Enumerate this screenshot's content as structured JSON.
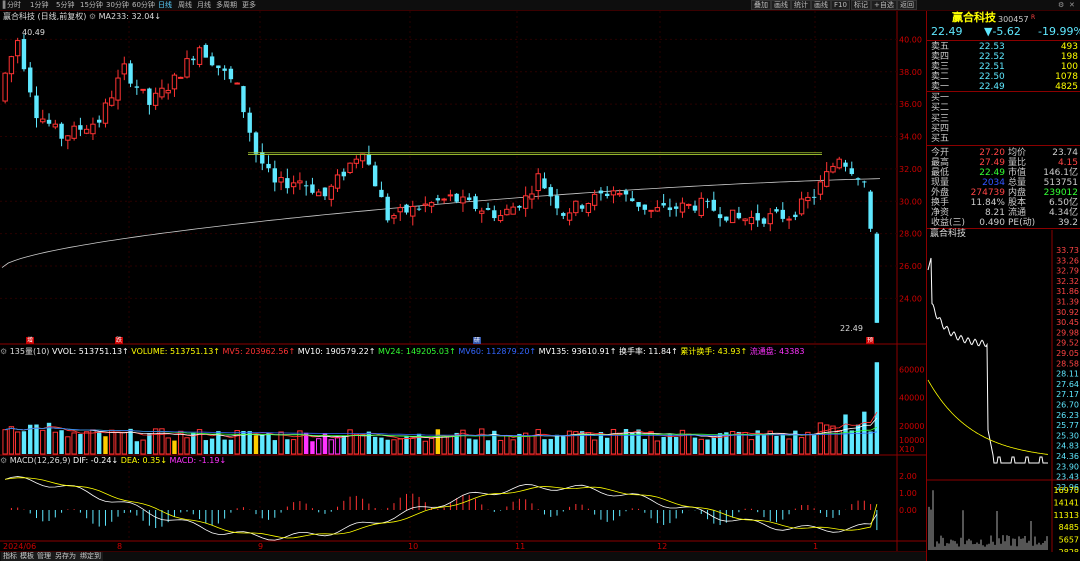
{
  "toolbar": {
    "periods": [
      "分时",
      "1分钟",
      "5分钟",
      "15分钟",
      "30分钟",
      "60分钟",
      "日线",
      "周线",
      "月线",
      "多周期",
      "更多"
    ],
    "active_period": "日线",
    "right_buttons": [
      "叠加",
      "画线",
      "统计",
      "画线",
      "F10",
      "标记",
      "+自选",
      "返回"
    ],
    "right_icons": [
      "settings-icon",
      "close-icon"
    ]
  },
  "chart_header": {
    "stock_name": "赢合科技",
    "mode": "(日线,前复权)",
    "ma_label": "MA233: 32.04↓"
  },
  "price_axis_labels": [
    "40.00",
    "38.00",
    "36.00",
    "34.00",
    "32.00",
    "30.00",
    "28.00",
    "26.00",
    "24.00"
  ],
  "high_label": "40.49",
  "low_label": "22.49",
  "markers": [
    "增",
    "跌",
    "研",
    "预"
  ],
  "volume_header": {
    "left": "135量(10)",
    "items": [
      {
        "text": "VVOL: 513751.13↑",
        "color": "#ffffff"
      },
      {
        "text": "VOLUME: 513751.13↑",
        "color": "#ffff00"
      },
      {
        "text": "MV5: 203962.56↑",
        "color": "#ff3333"
      },
      {
        "text": "MV10: 190579.22↑",
        "color": "#ffffff"
      },
      {
        "text": "MV24: 149205.03↑",
        "color": "#33ff33"
      },
      {
        "text": "MV60: 112879.20↑",
        "color": "#3366ff"
      },
      {
        "text": "MV135: 93610.91↑",
        "color": "#ffffff"
      },
      {
        "text": "换手率: 11.84↑",
        "color": "#ffffff"
      },
      {
        "text": "累计换手: 43.93↑",
        "color": "#ffff00"
      },
      {
        "text": "流通盘: 43383",
        "color": "#ff33ff"
      }
    ]
  },
  "volume_axis_labels": [
    "60000",
    "40000",
    "20000",
    "10000",
    "X10"
  ],
  "macd_header": {
    "left": "MACD(12,26,9)",
    "items": [
      {
        "text": "DIF: -0.24↓",
        "color": "#ffffff"
      },
      {
        "text": "DEA: 0.35↓",
        "color": "#ffff00"
      },
      {
        "text": "MACD: -1.19↓",
        "color": "#ff33ff"
      }
    ]
  },
  "macd_axis_labels": [
    "2.00",
    "1.00",
    "0.00"
  ],
  "date_labels": [
    "2024/06",
    "8",
    "9",
    "10",
    "11",
    "12",
    "1"
  ],
  "bottom_tabs": [
    "指标",
    "模板",
    "管理",
    "另存为",
    "绑定到"
  ],
  "quote": {
    "name": "赢合科技",
    "code": "300457",
    "last_price": "22.49",
    "change": "▼-5.62",
    "change_pct": "-19.99%",
    "asks": [
      {
        "label": "卖五",
        "price": "22.53",
        "vol": "493"
      },
      {
        "label": "卖四",
        "price": "22.52",
        "vol": "198"
      },
      {
        "label": "卖三",
        "price": "22.51",
        "vol": "100"
      },
      {
        "label": "卖二",
        "price": "22.50",
        "vol": "1078"
      },
      {
        "label": "卖一",
        "price": "22.49",
        "vol": "4825"
      }
    ],
    "bids": [
      "买一",
      "买二",
      "买三",
      "买四",
      "买五"
    ],
    "stats": [
      {
        "l1": "今开",
        "v1": "27.20",
        "l2": "均价",
        "v2": "23.74",
        "c1": "#ff4444",
        "c2": "#cccccc"
      },
      {
        "l1": "最高",
        "v1": "27.49",
        "l2": "量比",
        "v2": "4.15",
        "c1": "#ff4444",
        "c2": "#ff4444"
      },
      {
        "l1": "最低",
        "v1": "22.49",
        "l2": "市值",
        "v2": "146.1亿",
        "c1": "#33ff33",
        "c2": "#cccccc"
      },
      {
        "l1": "现量",
        "v1": "2034",
        "l2": "总量",
        "v2": "513751",
        "c1": "#3355ff",
        "c2": "#cccccc"
      },
      {
        "l1": "外盘",
        "v1": "274739",
        "l2": "内盘",
        "v2": "239012",
        "c1": "#ff4444",
        "c2": "#33ff33"
      },
      {
        "l1": "换手",
        "v1": "11.84%",
        "l2": "股本",
        "v2": "6.50亿",
        "c1": "#cccccc",
        "c2": "#cccccc"
      },
      {
        "l1": "净资",
        "v1": "8.21",
        "l2": "流通",
        "v2": "4.34亿",
        "c1": "#cccccc",
        "c2": "#cccccc"
      },
      {
        "l1": "收益(三)",
        "v1": "0.490",
        "l2": "PE(动)",
        "v2": "39.2",
        "c1": "#cccccc",
        "c2": "#cccccc"
      }
    ],
    "mini_title": "赢合科技",
    "mini_price_labels": [
      "33.73",
      "33.26",
      "32.79",
      "32.32",
      "31.86",
      "31.39",
      "30.92",
      "30.45",
      "29.98",
      "29.52",
      "29.05",
      "28.58",
      "28.11",
      "27.64",
      "27.17",
      "26.70",
      "26.23",
      "25.77",
      "25.30",
      "24.83",
      "24.36",
      "23.90",
      "23.43",
      "22.96"
    ],
    "mini_vol_labels": [
      "16970",
      "14141",
      "11313",
      "8485",
      "5657",
      "2828"
    ],
    "daily_tab": "日线"
  },
  "colors": {
    "up": "#ff3333",
    "down": "#5fe8ff",
    "bg": "#000000",
    "grid": "#8b0000",
    "ma233": "#cccccc",
    "resistance": "#aacc33"
  }
}
